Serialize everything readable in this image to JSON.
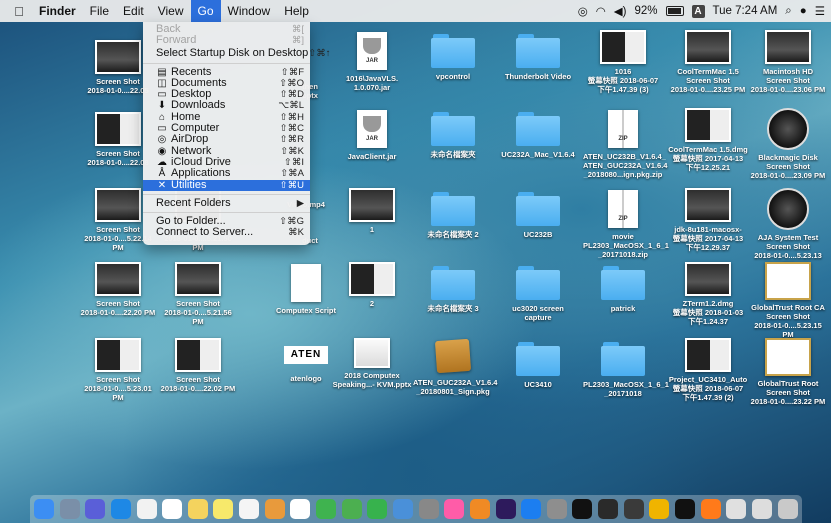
{
  "menubar": {
    "app_name": "Finder",
    "items": [
      "File",
      "Edit",
      "View",
      "Go",
      "Window",
      "Help"
    ],
    "active_item": "Go",
    "battery": "92%",
    "input_source": "A",
    "clock": "Tue 7:24 AM"
  },
  "go_menu": {
    "items": [
      {
        "label": "Back",
        "shortcut": "⌘[",
        "disabled": true
      },
      {
        "label": "Forward",
        "shortcut": "⌘]",
        "disabled": true
      },
      {
        "label": "Select Startup Disk on Desktop",
        "shortcut": "⇧⌘↑"
      },
      {
        "label": "Recents",
        "shortcut": "⇧⌘F",
        "icon": "recents-icon"
      },
      {
        "label": "Documents",
        "shortcut": "⇧⌘O",
        "icon": "documents-icon"
      },
      {
        "label": "Desktop",
        "shortcut": "⇧⌘D",
        "icon": "desktop-icon"
      },
      {
        "label": "Downloads",
        "shortcut": "⌥⌘L",
        "icon": "downloads-icon"
      },
      {
        "label": "Home",
        "shortcut": "⇧⌘H",
        "icon": "home-icon"
      },
      {
        "label": "Computer",
        "shortcut": "⇧⌘C",
        "icon": "computer-icon"
      },
      {
        "label": "AirDrop",
        "shortcut": "⇧⌘R",
        "icon": "airdrop-icon"
      },
      {
        "label": "Network",
        "shortcut": "⇧⌘K",
        "icon": "network-icon"
      },
      {
        "label": "iCloud Drive",
        "shortcut": "⇧⌘I",
        "icon": "icloud-icon"
      },
      {
        "label": "Applications",
        "shortcut": "⇧⌘A",
        "icon": "applications-icon"
      },
      {
        "label": "Utilities",
        "shortcut": "⇧⌘U",
        "icon": "utilities-icon",
        "selected": true
      },
      {
        "label": "Recent Folders",
        "shortcut": "▶"
      },
      {
        "label": "Go to Folder...",
        "shortcut": "⇧⌘G"
      },
      {
        "label": "Connect to Server...",
        "shortcut": "⌘K"
      }
    ]
  },
  "desktop_icons": [
    {
      "label": "Screen Shot\n2018-01-0....22.05",
      "kind": "screenshot"
    },
    {
      "label": "Screen Shot\n2018-01-0....22.08",
      "kind": "screenshot"
    },
    {
      "label": "Screen Shot\n2018-01-0....5.22.14 PM",
      "kind": "screenshot"
    },
    {
      "label": "Screen Shot\n2018-01-0....22.20 PM",
      "kind": "screenshot"
    },
    {
      "label": "Screen Shot\n2018-01-0....5.23.01 PM",
      "kind": "screenshot"
    },
    {
      "label": "Screen Shot\n2018-01-0....5.21.50 PM",
      "kind": "screenshot"
    },
    {
      "label": "Screen Shot\n2018-01-0....5.21.56 PM",
      "kind": "screenshot"
    },
    {
      "label": "Screen Shot\n2018-01-0....22.02 PM",
      "kind": "screenshot"
    },
    {
      "label": "then\noptx",
      "kind": "partial"
    },
    {
      "label": "duct",
      "kind": "partial"
    },
    {
      "label": "Video.mp4",
      "kind": "video"
    },
    {
      "label": "Computex Script",
      "kind": "doc"
    },
    {
      "label": "atenlogo",
      "kind": "aten"
    },
    {
      "label": "1016\\JavaVLS.\n1.0.070.jar",
      "kind": "jar"
    },
    {
      "label": "JavaClient.jar",
      "kind": "jar"
    },
    {
      "label": "1",
      "kind": "screenshot"
    },
    {
      "label": "2",
      "kind": "screenshot"
    },
    {
      "label": "2018 Computex\nSpeaking...- KVM.pptx",
      "kind": "pptx"
    },
    {
      "label": "vpcontrol",
      "kind": "folder"
    },
    {
      "label": "未命名檔案夾",
      "kind": "folder"
    },
    {
      "label": "未命名檔案夾 2",
      "kind": "folder"
    },
    {
      "label": "未命名檔案夾 3",
      "kind": "folder"
    },
    {
      "label": "ATEN_GUC232A_V1.6.4\n_20180801_Sign.pkg",
      "kind": "pkg"
    },
    {
      "label": "Thunderbolt Video",
      "kind": "folder"
    },
    {
      "label": "UC232A_Mac_V1.6.4",
      "kind": "folder"
    },
    {
      "label": "UC232B",
      "kind": "folder"
    },
    {
      "label": "uc3020 screen\ncapture",
      "kind": "folder"
    },
    {
      "label": "UC3410",
      "kind": "folder"
    },
    {
      "label": "1016\n螢幕快照 2018-06-07\n下午1.47.39 (3)",
      "kind": "screenshot"
    },
    {
      "label": "ATEN_UC232B_V1.6.4_\nATEN_GUC232A_V1.6.4\n_2018080...ign.pkg.zip",
      "kind": "zip"
    },
    {
      "label": "movie\nPL2303_MacOSX_1_6_1\n_20171018.zip",
      "kind": "zip"
    },
    {
      "label": "patrick",
      "kind": "folder"
    },
    {
      "label": "PL2303_MacOSX_1_6_1\n_20171018",
      "kind": "folder"
    },
    {
      "label": "CoolTermMac 1.5\nScreen Shot\n2018-01-0....23.25 PM",
      "kind": "screenshot"
    },
    {
      "label": "CoolTermMac 1.5.dmg\n螢幕快照 2017-04-13\n下午12.25.21",
      "kind": "screenshot"
    },
    {
      "label": "jdk-8u181-macosx-\n螢幕快照 2017-04-13\n下午12.29.37",
      "kind": "screenshot"
    },
    {
      "label": "ZTerm1.2.dmg\n螢幕快照 2018-01-03\n下午1.24.37",
      "kind": "screenshot"
    },
    {
      "label": "Project_UC3410_Auto\n螢幕快照 2018-06-07\n下午1.47.39 (2)",
      "kind": "screenshot"
    },
    {
      "label": "Macintosh HD\nScreen Shot\n2018-01-0....23.06 PM",
      "kind": "screenshot"
    },
    {
      "label": "Blackmagic Disk\nScreen Shot\n2018-01-0....23.09 PM",
      "kind": "round"
    },
    {
      "label": "AJA System Test\nScreen Shot\n2018-01-0....5.23.13 PM",
      "kind": "round"
    },
    {
      "label": "GlobalTrust Root CA\nScreen Shot\n2018-01-0....5.23.15 PM",
      "kind": "cert"
    },
    {
      "label": "GlobalTrust Root\nScreen Shot\n2018-01-0....23.22 PM",
      "kind": "cert"
    }
  ],
  "dock_apps": [
    "finder-icon",
    "launchpad-icon",
    "siri-icon",
    "safari-icon",
    "photos-icon",
    "calendar-icon",
    "notes-icon",
    "stickies-icon",
    "reminders-icon",
    "books-icon",
    "photos-app-icon",
    "numbers-icon",
    "messages-icon",
    "facetime-icon",
    "maps-icon",
    "lens-icon",
    "itunes-icon",
    "ibooks-icon",
    "premiere-icon",
    "appstore-icon",
    "preferences-icon",
    "terminal-icon",
    "grapher-icon",
    "obs-icon",
    "chrome-icon",
    "terminal2-icon",
    "firefox-icon",
    "downloads-stack-icon",
    "documents-stack-icon",
    "trash-icon"
  ],
  "colors": {
    "menu_highlight": "#2c6fdc",
    "folder": "#4aaef0"
  }
}
